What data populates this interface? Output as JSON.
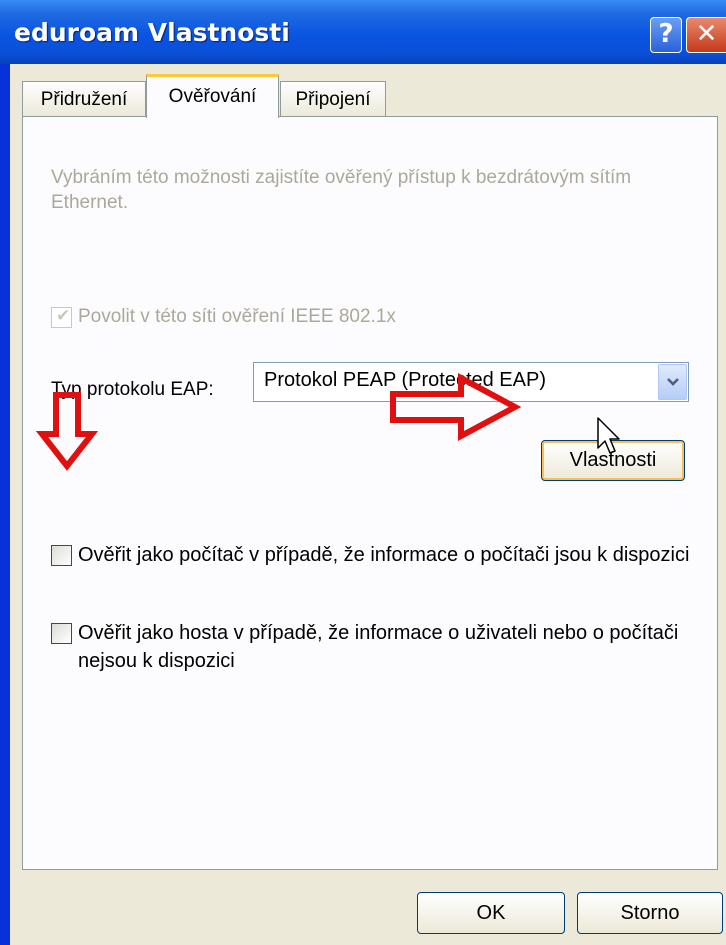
{
  "window": {
    "title": "eduroam Vlastnosti",
    "help_glyph": "?",
    "close_glyph": "✕"
  },
  "tabs": [
    {
      "label": "Přidružení",
      "active": false
    },
    {
      "label": "Ověřování",
      "active": true
    },
    {
      "label": "Připojení",
      "active": false
    }
  ],
  "auth": {
    "description": "Vybráním této možnosti zajistíte ověřený přístup k bezdrátovým sítím Ethernet.",
    "ieee_label": "Povolit v této síti ověření IEEE 802.1x",
    "ieee_checked": true,
    "ieee_enabled": false,
    "eap_label": "Typ protokolu EAP:",
    "eap_value": "Protokol PEAP (Protected EAP)",
    "properties_button": "Vlastnosti",
    "computer_auth_label": "Ověřit jako počítač v případě, že informace o počítači jsou k dispozici",
    "computer_auth_checked": false,
    "guest_auth_label": "Ověřit jako hosta v případě, že informace o uživateli nebo o počítači nejsou k dispozici",
    "guest_auth_checked": false
  },
  "buttons": {
    "ok": "OK",
    "cancel": "Storno"
  },
  "colors": {
    "annotation_arrow": "#e01010",
    "titlebar": "#0a54e3",
    "dialog_bg": "#ece9d8"
  },
  "icons": [
    "help-icon",
    "close-icon",
    "checkmark-icon",
    "chevron-down-icon",
    "arrow-down-icon",
    "arrow-right-icon",
    "mouse-cursor-icon"
  ]
}
